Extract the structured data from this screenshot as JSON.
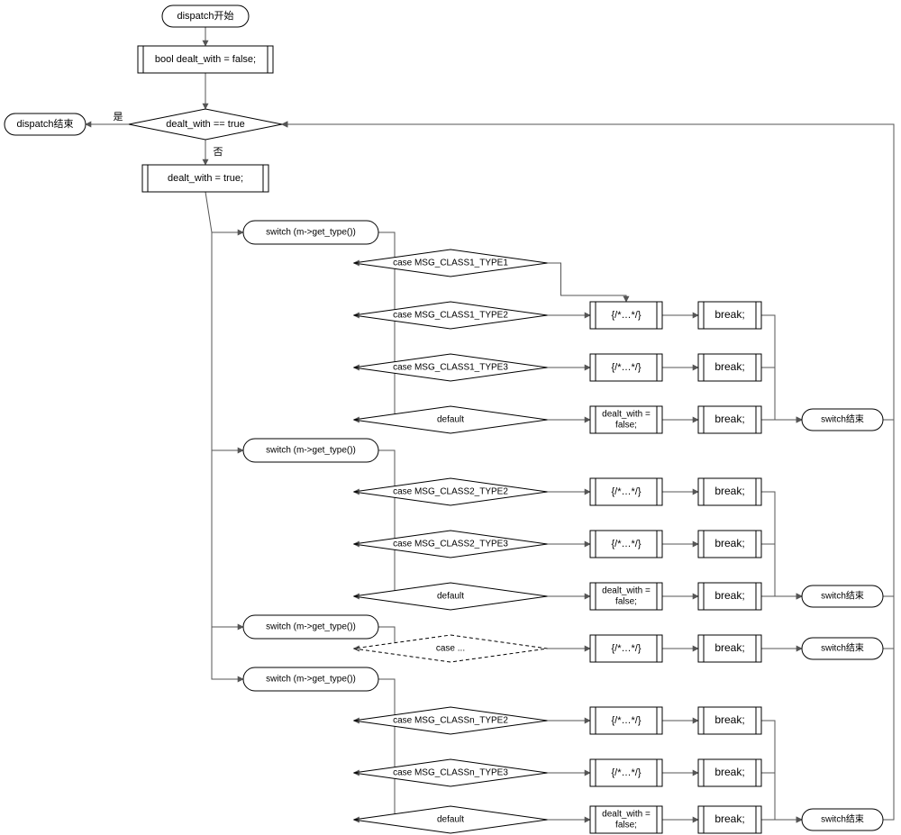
{
  "chart_data": {
    "type": "flowchart",
    "title": "dispatch flowchart",
    "nodes": {
      "start": {
        "label": "dispatch开始",
        "shape": "terminator"
      },
      "init": {
        "label": "bool dealt_with = false;",
        "shape": "process-sub"
      },
      "cond_dw": {
        "label": "dealt_with == true",
        "shape": "decision"
      },
      "end": {
        "label": "dispatch结束",
        "shape": "terminator"
      },
      "set_true": {
        "label": "dealt_with = true;",
        "shape": "process-sub"
      },
      "sw1": {
        "label": "switch (m->get_type())",
        "shape": "terminator"
      },
      "c1_1": {
        "label": "case MSG_CLASS1_TYPE1",
        "shape": "decision"
      },
      "c1_2": {
        "label": "case MSG_CLASS1_TYPE2",
        "shape": "decision"
      },
      "c1_3": {
        "label": "case MSG_CLASS1_TYPE3",
        "shape": "decision"
      },
      "c1_d": {
        "label": "default",
        "shape": "decision"
      },
      "a1_2": {
        "label": "{/*…*/}",
        "shape": "process-sub"
      },
      "a1_3": {
        "label": "{/*…*/}",
        "shape": "process-sub"
      },
      "a1_d": {
        "label": "dealt_with =\nfalse;",
        "shape": "process-sub"
      },
      "b1_2": {
        "label": "break;",
        "shape": "process-sub"
      },
      "b1_3": {
        "label": "break;",
        "shape": "process-sub"
      },
      "b1_d": {
        "label": "break;",
        "shape": "process-sub"
      },
      "sw1_end": {
        "label": "switch结束",
        "shape": "terminator"
      },
      "sw2": {
        "label": "switch (m->get_type())",
        "shape": "terminator"
      },
      "c2_2": {
        "label": "case MSG_CLASS2_TYPE2",
        "shape": "decision"
      },
      "c2_3": {
        "label": "case MSG_CLASS2_TYPE3",
        "shape": "decision"
      },
      "c2_d": {
        "label": "default",
        "shape": "decision"
      },
      "a2_2": {
        "label": "{/*…*/}",
        "shape": "process-sub"
      },
      "a2_3": {
        "label": "{/*…*/}",
        "shape": "process-sub"
      },
      "a2_d": {
        "label": "dealt_with =\nfalse;",
        "shape": "process-sub"
      },
      "b2_2": {
        "label": "break;",
        "shape": "process-sub"
      },
      "b2_3": {
        "label": "break;",
        "shape": "process-sub"
      },
      "b2_d": {
        "label": "break;",
        "shape": "process-sub"
      },
      "sw2_end": {
        "label": "switch结束",
        "shape": "terminator"
      },
      "sw3": {
        "label": "switch (m->get_type())",
        "shape": "terminator"
      },
      "c3_x": {
        "label": "case ...",
        "shape": "decision-dashed"
      },
      "a3_x": {
        "label": "{/*…*/}",
        "shape": "process-sub"
      },
      "b3_x": {
        "label": "break;",
        "shape": "process-sub"
      },
      "sw3_end": {
        "label": "switch结束",
        "shape": "terminator"
      },
      "sw4": {
        "label": "switch (m->get_type())",
        "shape": "terminator"
      },
      "c4_2": {
        "label": "case MSG_CLASSn_TYPE2",
        "shape": "decision"
      },
      "c4_3": {
        "label": "case MSG_CLASSn_TYPE3",
        "shape": "decision"
      },
      "c4_d": {
        "label": "default",
        "shape": "decision"
      },
      "a4_2": {
        "label": "{/*…*/}",
        "shape": "process-sub"
      },
      "a4_3": {
        "label": "{/*…*/}",
        "shape": "process-sub"
      },
      "a4_d": {
        "label": "dealt_with =\nfalse;",
        "shape": "process-sub"
      },
      "b4_2": {
        "label": "break;",
        "shape": "process-sub"
      },
      "b4_3": {
        "label": "break;",
        "shape": "process-sub"
      },
      "b4_d": {
        "label": "break;",
        "shape": "process-sub"
      },
      "sw4_end": {
        "label": "switch结束",
        "shape": "terminator"
      }
    },
    "edge_labels": {
      "yes": "是",
      "no": "否"
    }
  },
  "labels": {
    "yes": "是",
    "no": "否"
  }
}
